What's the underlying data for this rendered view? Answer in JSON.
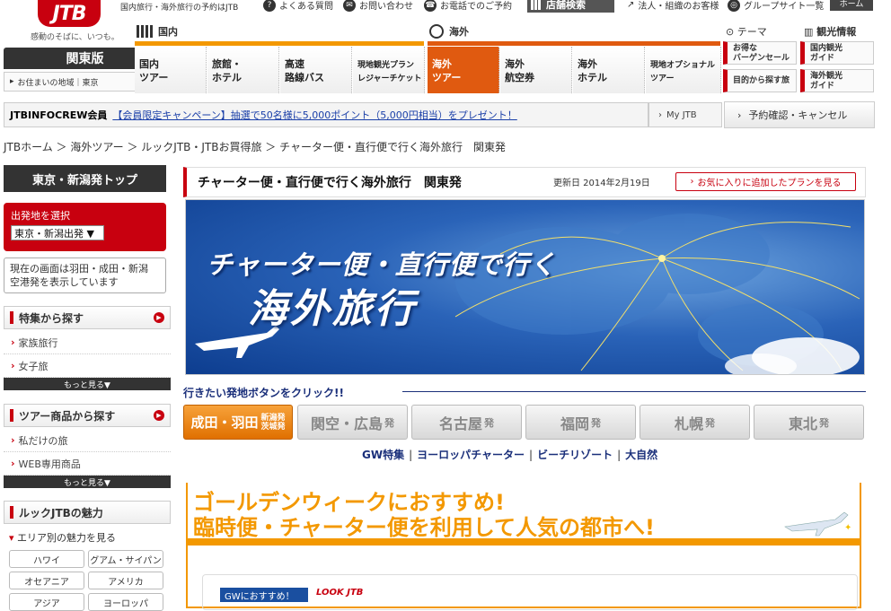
{
  "brand": {
    "logo": "JTB",
    "tagline": "感動のそばに、いつも。"
  },
  "topbar": {
    "note": "国内旅行・海外旅行の予約はJTB",
    "faq": "よくある質問",
    "contact": "お問い合わせ",
    "phone": "お電話でのご予約",
    "store": "店舗検索",
    "corp": "法人・組織のお客様",
    "group": "グループサイト一覧",
    "home": "ホーム"
  },
  "region": {
    "title": "関東版",
    "sub": "お住まいの地域｜東京"
  },
  "nav": {
    "domestic": "国内",
    "overseas": "海外",
    "theme": "テーマ",
    "kanko": "観光情報",
    "items": [
      {
        "label": "国内\nツアー"
      },
      {
        "label": "旅館・\nホテル"
      },
      {
        "label": "高速\n路線バス"
      },
      {
        "label": "現地観光プラン\nレジャーチケット"
      },
      {
        "label": "海外\nツアー"
      },
      {
        "label": "海外\n航空券"
      },
      {
        "label": "海外\nホテル"
      },
      {
        "label": "現地オプショナル\nツアー"
      }
    ],
    "side": [
      {
        "label": "お得な\nバーゲンセール"
      },
      {
        "label": "国内観光\nガイド"
      },
      {
        "label": "目的から探す旅"
      },
      {
        "label": "海外観光\nガイド"
      }
    ]
  },
  "member": {
    "brand": "JTBINFOCREW会員",
    "campaign": "【会員限定キャンペーン】抽選で50名様に5,000ポイント（5,000円相当）をプレゼント！",
    "myjtb": "My JTB",
    "reserve": "予約確認・キャンセル"
  },
  "breadcrumb": "JTBホーム ＞ 海外ツアー ＞ ルックJTB・JTBお買得旅 ＞ チャーター便・直行便で行く海外旅行　関東発",
  "sidebar": {
    "top": "東京・新潟発トップ",
    "dep_label": "出発地を選択",
    "dep_value": "東京・新潟出発 ▼",
    "dep_note": "現在の画面は羽田・成田・新潟\n空港発を表示しています",
    "feature_head": "特集から探す",
    "feature_items": [
      "家族旅行",
      "女子旅"
    ],
    "more": "もっと見る▼",
    "product_head": "ツアー商品から探す",
    "product_items": [
      "私だけの旅",
      "WEB専用商品"
    ],
    "look_head": "ルックJTBの魅力",
    "area_head": "エリア別の魅力を見る",
    "areas": [
      "ハワイ",
      "グアム・サイパン",
      "オセアニア",
      "アメリカ",
      "アジア",
      "ヨーロッパ"
    ]
  },
  "content": {
    "title": "チャーター便・直行便で行く海外旅行　関東発",
    "updated": "更新日 2014年2月19日",
    "fav": "お気に入りに追加したプランを見る",
    "banner1": "チャーター便・直行便で行く",
    "banner2": "海外旅行",
    "prompt": "行きたい発地ボタンをクリック!!",
    "departures": [
      {
        "main": "成田・羽田",
        "sub": "新潟発\n茨城発"
      },
      {
        "main": "関空・広島",
        "sub": "発"
      },
      {
        "main": "名古屋",
        "sub": "発"
      },
      {
        "main": "福岡",
        "sub": "発"
      },
      {
        "main": "札幌",
        "sub": "発"
      },
      {
        "main": "東北",
        "sub": "発"
      }
    ],
    "links": [
      "GW特集",
      "ヨーロッパチャーター",
      "ビーチリゾート",
      "大自然"
    ],
    "gw1": "ゴールデンウィークにおすすめ!",
    "gw2": "臨時便・チャーター便を利用して人気の都市へ!",
    "gwtag": "GWにおすすめ！",
    "look": "LOOK JTB"
  },
  "colors": {
    "brand_red": "#c8000f",
    "orange": "#f39800",
    "navy": "#1a2f7a"
  }
}
